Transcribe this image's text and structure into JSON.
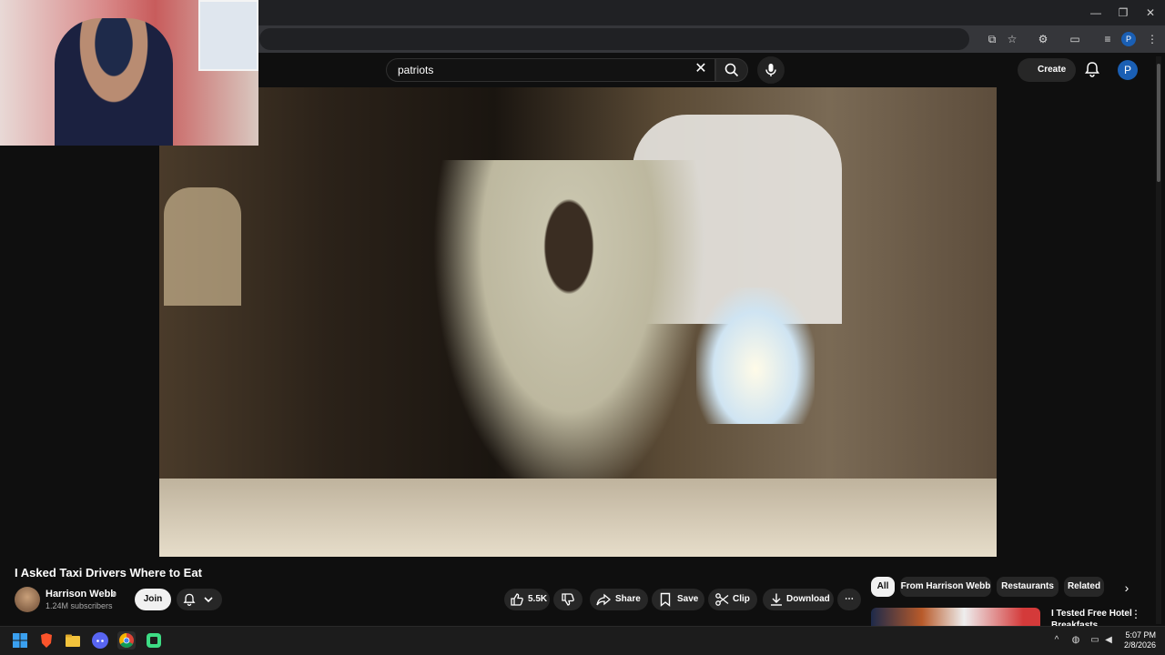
{
  "search": {
    "query": "patriots"
  },
  "header": {
    "create_label": "Create",
    "avatar_letter": "P"
  },
  "browser": {
    "profile_letter": "P"
  },
  "video": {
    "title": "I Asked Taxi Drivers Where to Eat",
    "channel_name": "Harrison Webb",
    "subscribers": "1.24M subscribers",
    "join_label": "Join",
    "likes": "5.5K",
    "share_label": "Share",
    "save_label": "Save",
    "clip_label": "Clip",
    "download_label": "Download"
  },
  "chips": [
    {
      "label": "All",
      "selected": true
    },
    {
      "label": "From Harrison Webb",
      "selected": false
    },
    {
      "label": "Restaurants",
      "selected": false
    },
    {
      "label": "Related",
      "selected": false
    }
  ],
  "recommendation": {
    "title": "I Tested Free Hotel Breakfasts"
  },
  "taskbar": {
    "time": "5:07 PM",
    "date": "2/8/2026"
  },
  "colors": {
    "background": "#0f0f0f",
    "pill": "#272727",
    "accent_avatar": "#1a5fb4"
  }
}
